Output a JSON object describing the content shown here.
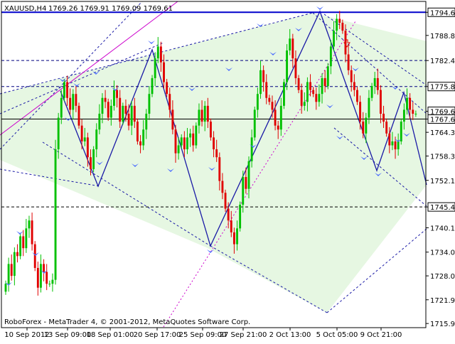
{
  "chart_data": {
    "type": "candlestick",
    "header": {
      "symbol": "XAUUSD,H4",
      "ohlc": "1769.26 1769.91 1769.09 1769.61"
    },
    "footer_text": "RoboForex - MetaTrader 4, © 2001-2012, MetaQuotes Software Corp.",
    "ylim": [
      1714.9,
      1797.4
    ],
    "y_ticks": [
      "1794.65",
      "1788.80",
      "1782.45",
      "1775.88",
      "1769.61",
      "1767.65",
      "1764.30",
      "1758.30",
      "1752.15",
      "1745.43",
      "1740.15",
      "1734.00",
      "1728.00",
      "1721.95",
      "1715.95"
    ],
    "highlighted_ticks": [
      "1794.65",
      "1775.88",
      "1769.61",
      "1767.65",
      "1745.43"
    ],
    "x_ticks": [
      "10 Sep 2012",
      "13 Sep 09:00",
      "18 Sep 01:00",
      "20 Sep 17:00",
      "25 Sep 09:00",
      "27 Sep 21:00",
      "2 Oct 13:00",
      "5 Oct 05:00",
      "9 Oct 21:00"
    ],
    "horizontal_levels": [
      {
        "value": 1794.65,
        "style": "solid",
        "color": "#0000cc"
      },
      {
        "value": 1782.45,
        "style": "dashed",
        "color": "#000080"
      },
      {
        "value": 1775.88,
        "style": "dashed",
        "color": "#000080"
      },
      {
        "value": 1767.65,
        "style": "solid",
        "color": "#000000"
      },
      {
        "value": 1745.43,
        "style": "dashed",
        "color": "#000000"
      }
    ],
    "up_color": "#00c000",
    "down_color": "#e00000",
    "channel_fill": "#e6f7e2",
    "series": [
      {
        "name": "close",
        "values": [
          1726,
          1731,
          1728,
          1734,
          1733,
          1738,
          1735,
          1740,
          1742,
          1736,
          1730,
          1725,
          1731,
          1729,
          1726,
          1726,
          1727,
          1760,
          1768,
          1773,
          1777,
          1773,
          1770,
          1774,
          1771,
          1766,
          1762,
          1763,
          1758,
          1755,
          1760,
          1765,
          1769,
          1773,
          1772,
          1768,
          1771,
          1775,
          1773,
          1767,
          1771,
          1769,
          1766,
          1771,
          1767,
          1762,
          1761,
          1765,
          1769,
          1774,
          1778,
          1783,
          1786,
          1782,
          1777,
          1774,
          1770,
          1765,
          1759,
          1761,
          1763,
          1760,
          1763,
          1764,
          1761,
          1766,
          1770,
          1767,
          1771,
          1767,
          1763,
          1760,
          1758,
          1752,
          1749,
          1745,
          1742,
          1739,
          1736,
          1740,
          1746,
          1753,
          1750,
          1757,
          1763,
          1770,
          1774,
          1780,
          1777,
          1773,
          1772,
          1770,
          1766,
          1765,
          1771,
          1777,
          1785,
          1788,
          1783,
          1778,
          1775,
          1771,
          1772,
          1777,
          1775,
          1774,
          1772,
          1774,
          1778,
          1776,
          1781,
          1786,
          1790,
          1793,
          1792,
          1790,
          1784,
          1780,
          1777,
          1775,
          1772,
          1767,
          1764,
          1768,
          1773,
          1776,
          1778,
          1775,
          1769,
          1767,
          1764,
          1761,
          1762,
          1760,
          1762,
          1767,
          1770,
          1773,
          1770,
          1769,
          1769
        ]
      }
    ]
  }
}
